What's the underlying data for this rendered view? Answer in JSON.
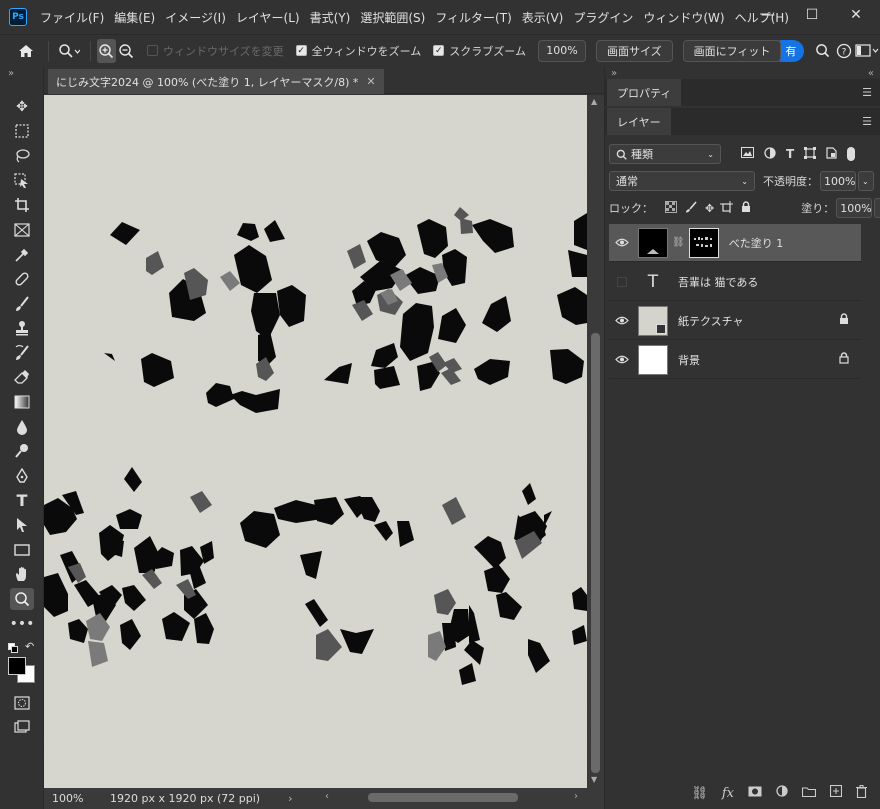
{
  "app": {
    "logo": "Ps",
    "menus": [
      "ファイル(F)",
      "編集(E)",
      "イメージ(I)",
      "レイヤー(L)",
      "書式(Y)",
      "選択範囲(S)",
      "フィルター(T)",
      "表示(V)",
      "プラグイン",
      "ウィンドウ(W)",
      "ヘルプ(H)"
    ],
    "window_controls": [
      "—",
      "☐",
      "✕"
    ]
  },
  "options": {
    "home_icon": "home-icon",
    "zoom_icon": "zoom-icon",
    "resize_windows_label": "ウィンドウサイズを変更",
    "resize_windows_checked": false,
    "zoom_all_label": "全ウィンドウをズーム",
    "zoom_all_checked": true,
    "scrubby_label": "スクラブズーム",
    "scrubby_checked": true,
    "zoom_value": "100%",
    "fit_screen_label": "画面サイズ",
    "fill_screen_label": "画面にフィット",
    "share_label": "有"
  },
  "document": {
    "tab_title": "にじみ文字2024 @ 100% (べた塗り 1, レイヤーマスク/8) *",
    "zoom": "100%",
    "doc_info": "1920 px x 1920 px (72 ppi)"
  },
  "panels": {
    "properties_tab": "プロパティ",
    "layers_tab": "レイヤー",
    "filter_kind": "種類",
    "blend_mode": "通常",
    "opacity_label": "不透明度：",
    "opacity_value": "100%",
    "lock_label": "ロック：",
    "fill_label": "塗り：",
    "fill_value": "100%",
    "layers": [
      {
        "name": "べた塗り 1",
        "selected": true,
        "visible": true,
        "locked": false
      },
      {
        "name": "吾輩は 猫である",
        "selected": false,
        "visible": false,
        "locked": false
      },
      {
        "name": "紙テクスチャ",
        "selected": false,
        "visible": true,
        "locked": true
      },
      {
        "name": "背景",
        "selected": false,
        "visible": true,
        "locked": true
      }
    ]
  }
}
